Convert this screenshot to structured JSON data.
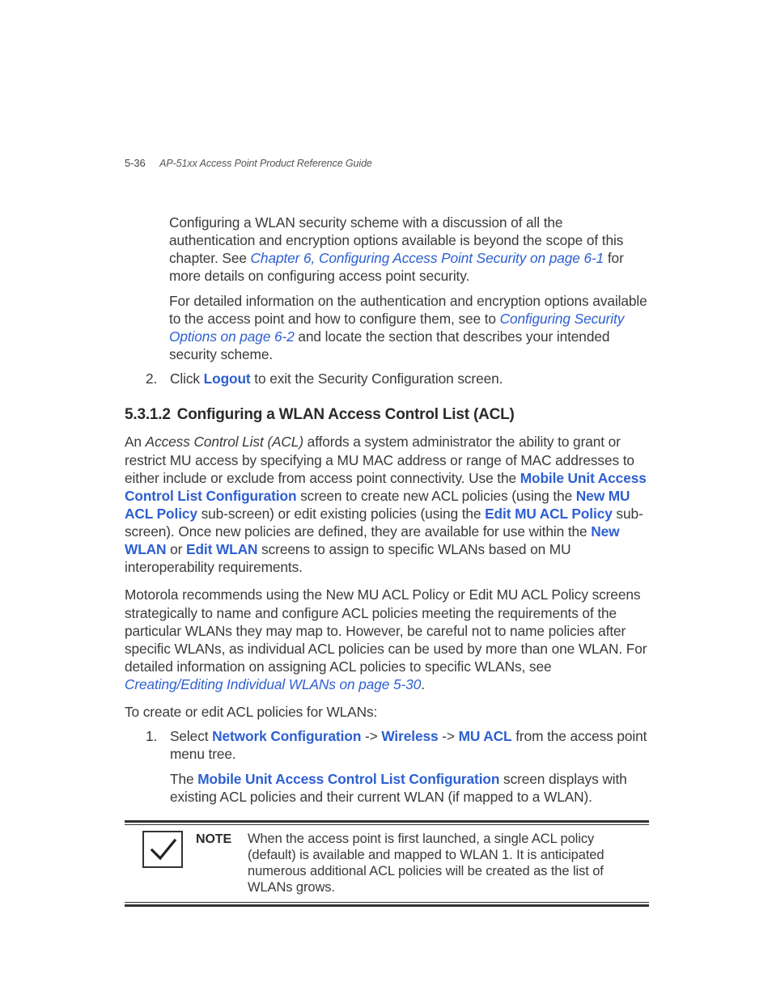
{
  "header": {
    "page_number": "5-36",
    "doc_title": "AP-51xx Access Point Product Reference Guide"
  },
  "intro": {
    "p1_a": "Configuring a WLAN security scheme with a discussion of all the authentication and encryption options available is beyond the scope of this chapter. See ",
    "p1_link": "Chapter 6, Configuring Access Point Security on page 6-1",
    "p1_b": " for more details on configuring access point security.",
    "p2_a": "For detailed information on the authentication and encryption options available to the access point and how to configure them, see to ",
    "p2_link": "Configuring Security Options on page 6-2",
    "p2_b": " and locate the section that describes your intended security scheme."
  },
  "step2": {
    "num": "2.",
    "a": "Click ",
    "bold": "Logout",
    "b": " to exit the Security Configuration screen."
  },
  "section": {
    "number": "5.3.1.2",
    "title": "Configuring a WLAN Access Control List (ACL)"
  },
  "acl": {
    "p1": {
      "a": "An ",
      "ital": "Access Control List (ACL)",
      "b": " affords a system administrator the ability to grant or restrict MU access by specifying a MU MAC address or range of MAC addresses to either include or exclude from access point connectivity. Use the ",
      "bb1": "Mobile Unit Access Control List Configuration",
      "c": " screen to create new ACL policies (using the ",
      "bb2": "New MU ACL Policy",
      "d": " sub-screen) or edit existing policies (using the ",
      "bb3": "Edit MU ACL Policy",
      "e": " sub-screen). Once new policies are defined, they are available for use within the ",
      "bb4": "New WLAN",
      "f": " or ",
      "bb5": "Edit WLAN",
      "g": " screens to assign to specific WLANs based on MU interoperability requirements."
    },
    "p2": {
      "a": "Motorola recommends using the New MU ACL Policy or Edit MU ACL Policy screens strategically to name and configure ACL policies meeting the requirements of the particular WLANs they may map to. However, be careful not to name policies after specific WLANs, as individual ACL policies can be used by more than one WLAN. For detailed information on assigning ACL policies to specific WLANs, see ",
      "link": "Creating/Editing Individual WLANs on page 5-30",
      "b": "."
    },
    "p3": "To create or edit ACL policies for WLANs:"
  },
  "step1": {
    "num": "1.",
    "a": "Select ",
    "bb1": "Network Configuration",
    "arrow1": " -> ",
    "bb2": "Wireless",
    "arrow2": " -> ",
    "bb3": "MU ACL",
    "b": " from the access point menu tree.",
    "line2_a": "The ",
    "line2_bb": "Mobile Unit Access Control List Configuration",
    "line2_b": " screen displays with existing ACL policies and their current WLAN (if mapped to a WLAN)."
  },
  "note": {
    "label": "NOTE",
    "text": "When the access point is first launched, a single ACL policy (default) is available and mapped to WLAN 1. It is anticipated numerous additional ACL policies will be created as the list of WLANs grows."
  }
}
